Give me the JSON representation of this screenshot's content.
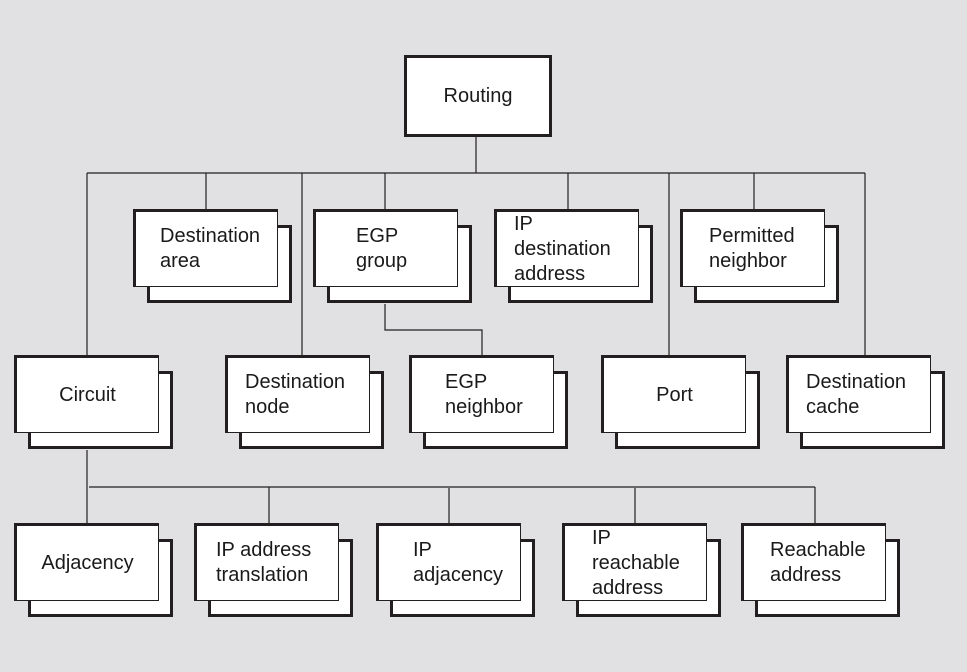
{
  "root": {
    "label": "Routing"
  },
  "children": [
    {
      "lines": [
        "Destination",
        "area"
      ]
    },
    {
      "lines": [
        "EGP",
        "group"
      ]
    },
    {
      "lines": [
        "IP",
        "destination",
        "address"
      ]
    },
    {
      "lines": [
        "Permitted",
        "neighbor"
      ]
    },
    {
      "lines": [
        "Circuit"
      ]
    },
    {
      "lines": [
        "Destination",
        "node"
      ]
    },
    {
      "lines": [
        "EGP",
        "neighbor"
      ]
    },
    {
      "lines": [
        "Port"
      ]
    },
    {
      "lines": [
        "Destination",
        "cache"
      ]
    }
  ],
  "circuit_children": [
    {
      "lines": [
        "Adjacency"
      ]
    },
    {
      "lines": [
        "IP address",
        "translation"
      ]
    },
    {
      "lines": [
        "IP",
        "adjacency"
      ]
    },
    {
      "lines": [
        "IP",
        "reachable",
        "address"
      ]
    },
    {
      "lines": [
        "Reachable",
        "address"
      ]
    }
  ]
}
